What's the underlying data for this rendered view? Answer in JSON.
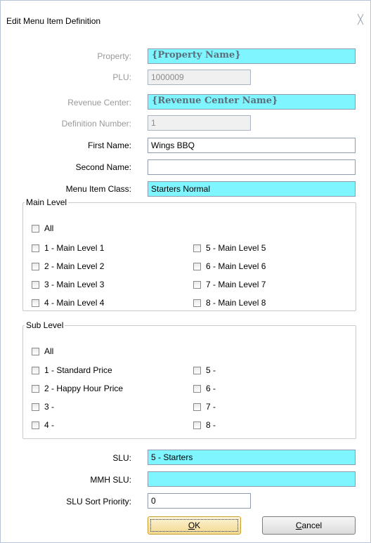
{
  "window": {
    "title": "Edit Menu Item Definition",
    "close_glyph": "╳"
  },
  "form": {
    "property": {
      "label": "Property:",
      "value": "{Property Name}"
    },
    "plu": {
      "label": "PLU:",
      "value": "1000009"
    },
    "revenue_center": {
      "label": "Revenue Center:",
      "value": "{Revenue Center Name}"
    },
    "definition_number": {
      "label": "Definition Number:",
      "value": "1"
    },
    "first_name": {
      "label": "First Name:",
      "value": "Wings BBQ"
    },
    "second_name": {
      "label": "Second Name:",
      "value": ""
    },
    "menu_item_class": {
      "label": "Menu Item Class:",
      "value": "Starters Normal"
    },
    "slu": {
      "label": "SLU:",
      "value": "5 - Starters"
    },
    "mmh_slu": {
      "label": "MMH SLU:",
      "value": ""
    },
    "slu_sort_priority": {
      "label": "SLU Sort Priority:",
      "value": "0"
    }
  },
  "main_level": {
    "legend": "Main Level",
    "all": "All",
    "items": [
      "1 - Main Level 1",
      "2 - Main Level 2",
      "3 - Main Level 3",
      "4 - Main Level 4",
      "5 - Main Level 5",
      "6 - Main Level 6",
      "7 - Main Level 7",
      "8 - Main Level 8"
    ]
  },
  "sub_level": {
    "legend": "Sub Level",
    "all": "All",
    "items": [
      "1 - Standard Price",
      "2 - Happy Hour Price",
      "3 -",
      "4 -",
      "5 -",
      "6 -",
      "7 -",
      "8 -"
    ]
  },
  "buttons": {
    "ok_mnemonic": "O",
    "ok_rest": "K",
    "cancel_mnemonic": "C",
    "cancel_rest": "ancel"
  },
  "colors": {
    "highlight_field": "#7ff6ff",
    "default_button": "#f3d98e"
  }
}
